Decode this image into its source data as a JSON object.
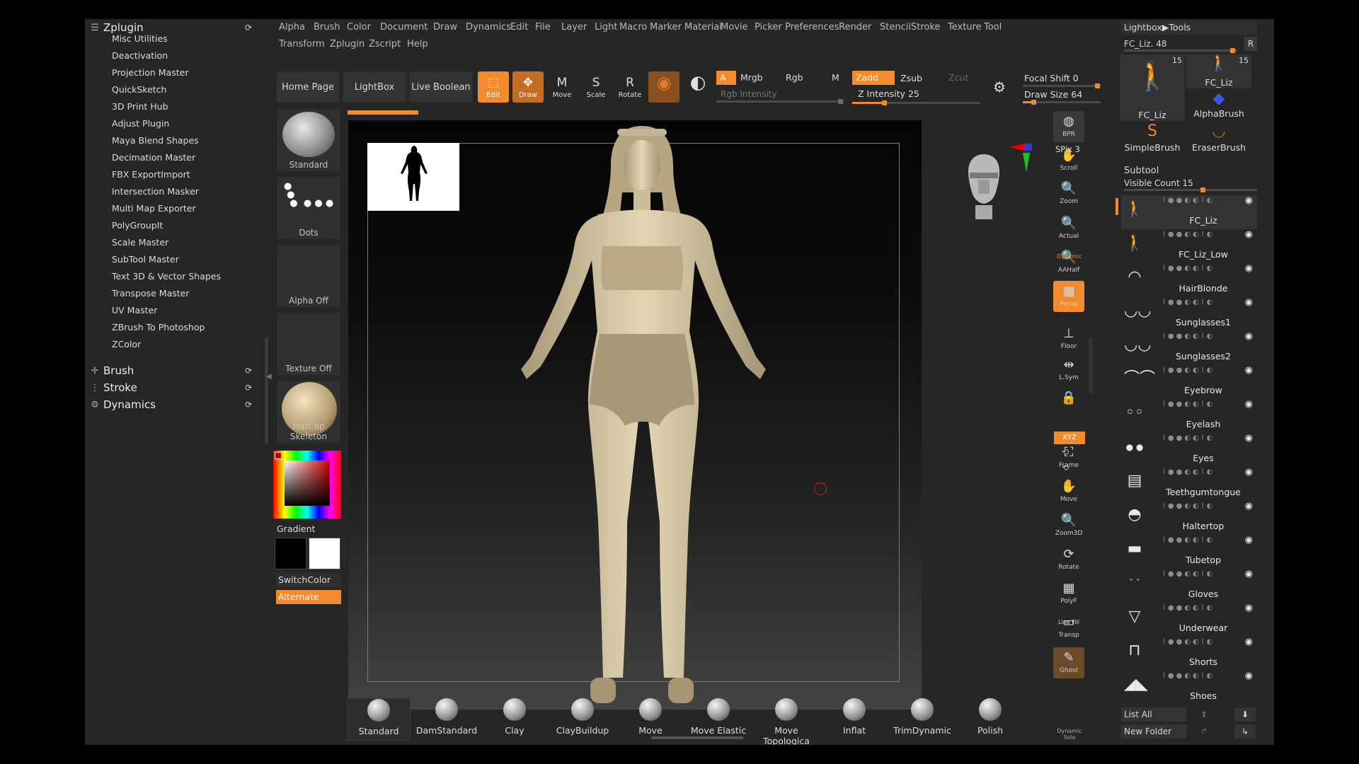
{
  "menu": {
    "row1": [
      "Alpha",
      "Brush",
      "Color",
      "Document",
      "Draw",
      "Dynamics",
      "Edit",
      "File",
      "Layer",
      "Light",
      "Macro",
      "Marker",
      "Material",
      "Movie",
      "Picker",
      "Preferences",
      "Render",
      "Stencil",
      "Stroke",
      "Texture",
      "Tool"
    ],
    "row2": [
      "Transform",
      "Zplugin",
      "Zscript",
      "Help"
    ]
  },
  "plugin_panel": {
    "title": "Zplugin",
    "items": [
      "Misc Utilities",
      "Deactivation",
      "Projection Master",
      "QuickSketch",
      "3D Print Hub",
      "Adjust Plugin",
      "Maya Blend Shapes",
      "Decimation Master",
      "FBX ExportImport",
      "Intersection Masker",
      "Multi Map Exporter",
      "PolyGroupIt",
      "Scale Master",
      "SubTool Master",
      "Text 3D & Vector Shapes",
      "Transpose Master",
      "UV Master",
      "ZBrush To Photoshop",
      "ZColor"
    ],
    "sections": [
      "Brush",
      "Stroke",
      "Dynamics"
    ]
  },
  "shelf": {
    "home": "Home Page",
    "lightbox": "LightBox",
    "live_boolean": "Live Boolean",
    "tools": [
      {
        "label": "Edit",
        "icon": "edit-icon",
        "glyph": "⬚",
        "active": true
      },
      {
        "label": "Draw",
        "icon": "draw-icon",
        "glyph": "✥",
        "active": true
      },
      {
        "label": "Move",
        "icon": "move-icon",
        "glyph": "M",
        "active": false
      },
      {
        "label": "Scale",
        "icon": "scale-icon",
        "glyph": "S",
        "active": false
      },
      {
        "label": "Rotate",
        "icon": "rotate-icon",
        "glyph": "R",
        "active": false
      }
    ],
    "a": "A",
    "mrgb": "Mrgb",
    "rgb": "Rgb",
    "m": "M",
    "rgb_intensity": "Rgb Intensity",
    "zadd": "Zadd",
    "zsub": "Zsub",
    "zcut": "Zcut",
    "z_intensity_label": "Z Intensity",
    "z_intensity": 25,
    "focal_shift_label": "Focal Shift",
    "focal_shift": 0,
    "draw_size_label": "Draw Size",
    "draw_size": 64
  },
  "left_column": {
    "brush": "Standard",
    "stroke": "Dots",
    "alpha": "Alpha Off",
    "texture": "Texture Off",
    "material": "MatCap Skeleton",
    "gradient": "Gradient",
    "switch_color": "SwitchColor",
    "alternate": "Alternate"
  },
  "right_dock": [
    {
      "label": "BPR",
      "icon": "bpr-icon",
      "glyph": "◍"
    },
    {
      "label": "Scroll",
      "icon": "scroll-hand-icon",
      "glyph": "✋"
    },
    {
      "label": "Zoom",
      "icon": "zoom-icon",
      "glyph": "🔍"
    },
    {
      "label": "Actual",
      "icon": "actual-icon",
      "glyph": "🔍"
    },
    {
      "label": "AAHalf",
      "icon": "aahalf-icon",
      "glyph": "🔍"
    },
    {
      "label": "Persp",
      "icon": "persp-icon",
      "glyph": "▦"
    },
    {
      "label": "Floor",
      "icon": "floor-icon",
      "glyph": "⊥"
    },
    {
      "label": "L.Sym",
      "icon": "lsym-icon",
      "glyph": "⇹"
    },
    {
      "label": "",
      "icon": "lock-icon",
      "glyph": "🔒"
    },
    {
      "label": "Frame",
      "icon": "frame-icon",
      "glyph": "⛶"
    },
    {
      "label": "Move",
      "icon": "move3d-icon",
      "glyph": "✋"
    },
    {
      "label": "Zoom3D",
      "icon": "zoom3d-icon",
      "glyph": "🔍"
    },
    {
      "label": "Rotate",
      "icon": "rotate3d-icon",
      "glyph": "⟳"
    },
    {
      "label": "PolyF",
      "icon": "polyf-icon",
      "glyph": "▦"
    },
    {
      "label": "Transp",
      "icon": "transp-icon",
      "glyph": "▭"
    },
    {
      "label": "Ghost",
      "icon": "ghost-icon",
      "glyph": "✎"
    }
  ],
  "dock_extra": {
    "spix_label": "SPix",
    "spix": 3,
    "dynamic": "Dynamic",
    "line_fill": "Line Fill",
    "xyz": "XYZ",
    "solo": "Solo"
  },
  "tray": {
    "header": "Lightbox▶Tools",
    "current_tool": "FC_Liz. 48",
    "r": "R",
    "tools": [
      {
        "name": "FC_Liz",
        "count": "15",
        "icon": "figure-icon"
      },
      {
        "name": "FC_Liz",
        "count": "15",
        "icon": "figure-small-icon"
      },
      {
        "name": "AlphaBrush",
        "count": "",
        "icon": "alphabrush-icon"
      },
      {
        "name": "SimpleBrush",
        "count": "",
        "icon": "simplebrush-icon"
      },
      {
        "name": "EraserBrush",
        "count": "",
        "icon": "eraserbrush-icon"
      }
    ],
    "subtool_title": "Subtool",
    "visible_count_label": "Visible Count",
    "visible_count": 15,
    "subtools": [
      {
        "name": "FC_Liz",
        "glyph": "🚶"
      },
      {
        "name": "FC_Liz_Low",
        "glyph": "🚶"
      },
      {
        "name": "HairBlonde",
        "glyph": "◠"
      },
      {
        "name": "Sunglasses1",
        "glyph": "◡◡"
      },
      {
        "name": "Sunglasses2",
        "glyph": "◡◡"
      },
      {
        "name": "Eyebrow",
        "glyph": "⌒⌒"
      },
      {
        "name": "Eyelash",
        "glyph": "◦◦"
      },
      {
        "name": "Eyes",
        "glyph": "● ●"
      },
      {
        "name": "Teethgumtongue",
        "glyph": "▤"
      },
      {
        "name": "Haltertop",
        "glyph": "◓"
      },
      {
        "name": "Tubetop",
        "glyph": "▬"
      },
      {
        "name": "Gloves",
        "glyph": "ˇ ˇ"
      },
      {
        "name": "Underwear",
        "glyph": "▽"
      },
      {
        "name": "Shorts",
        "glyph": "⊓"
      },
      {
        "name": "Shoes",
        "glyph": "◢◣"
      }
    ],
    "list_all": "List All",
    "new_folder": "New Folder"
  },
  "brushes": [
    "Standard",
    "DamStandard",
    "Clay",
    "ClayBuildup",
    "Move",
    "Move Elastic",
    "Move Topologica",
    "Inflat",
    "TrimDynamic",
    "Polish"
  ],
  "colors": {
    "accent": "#f28a2e",
    "panel": "#262626",
    "skin": "#d8cba4"
  }
}
